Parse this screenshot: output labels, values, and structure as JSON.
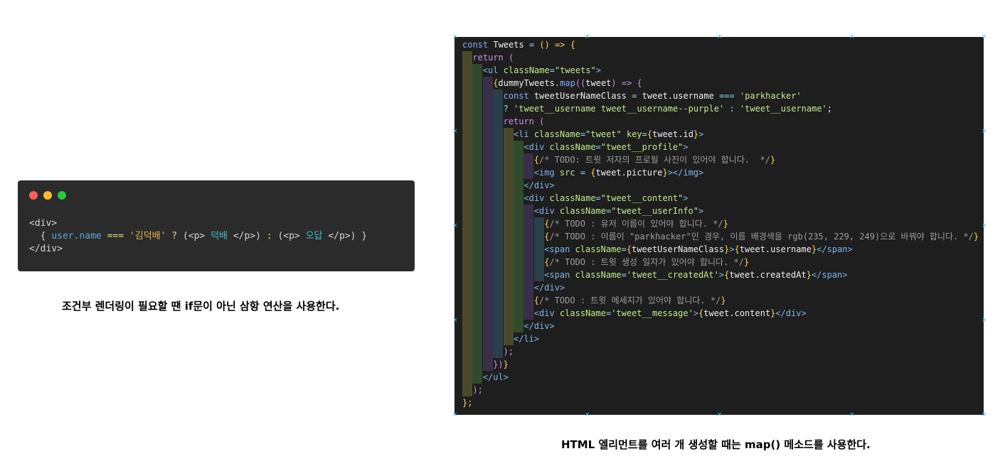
{
  "left_panel": {
    "dot_colors": [
      "#ff5f57",
      "#febc2e",
      "#28c840"
    ],
    "snippet_lines": [
      [
        {
          "t": "<div>",
          "c": "plain"
        }
      ],
      [
        {
          "t": "  { ",
          "c": "plain"
        },
        {
          "t": "user.name",
          "c": "var"
        },
        {
          "t": " === ",
          "c": "op"
        },
        {
          "t": "'김덕배'",
          "c": "str"
        },
        {
          "t": " ? ",
          "c": "op"
        },
        {
          "t": "(<p> ",
          "c": "plain"
        },
        {
          "t": "덕배",
          "c": "kor"
        },
        {
          "t": " </p>) ",
          "c": "plain"
        },
        {
          "t": ":",
          "c": "op"
        },
        {
          "t": " (<p> ",
          "c": "plain"
        },
        {
          "t": "오답",
          "c": "kor"
        },
        {
          "t": " </p>) }",
          "c": "plain"
        }
      ],
      [
        {
          "t": "</div>",
          "c": "plain"
        }
      ]
    ],
    "caption": "조건부 렌더링이 필요할 땐 if문이 아닌 삼항 연산을 사용한다."
  },
  "right_panel": {
    "caption": "HTML 엘리먼트를 여러 개 생성할 때는 map() 메소드를 사용한다.",
    "guide_colors": [
      "#4a4a2a",
      "#2f4a2f",
      "#3a2f4a",
      "#2a3f4a",
      "#4a4a2a",
      "#2f4a2f",
      "#3a2f4a",
      "#2a3f4a"
    ],
    "code_lines": [
      {
        "i": 0,
        "s": [
          {
            "t": "const ",
            "c": "var"
          },
          {
            "t": "Tweets",
            "c": "plain"
          },
          {
            "t": " = ",
            "c": "punc"
          },
          {
            "t": "() => {",
            "c": "brace"
          }
        ]
      },
      {
        "i": 1,
        "s": [
          {
            "t": "return (",
            "c": "kw"
          }
        ]
      },
      {
        "i": 2,
        "s": [
          {
            "t": "<ul ",
            "c": "tag"
          },
          {
            "t": "className",
            "c": "attr"
          },
          {
            "t": "=",
            "c": "punc"
          },
          {
            "t": "\"tweets\"",
            "c": "str"
          },
          {
            "t": ">",
            "c": "tag"
          }
        ]
      },
      {
        "i": 3,
        "s": [
          {
            "t": "{",
            "c": "brace"
          },
          {
            "t": "dummyTweets",
            "c": "plain"
          },
          {
            "t": ".",
            "c": "punc"
          },
          {
            "t": "map",
            "c": "fn"
          },
          {
            "t": "((",
            "c": "kw"
          },
          {
            "t": "tweet",
            "c": "plain"
          },
          {
            "t": ") => {",
            "c": "kw"
          }
        ]
      },
      {
        "i": 4,
        "s": [
          {
            "t": "const ",
            "c": "var"
          },
          {
            "t": "tweetUserNameClass",
            "c": "plain"
          },
          {
            "t": " = ",
            "c": "punc"
          },
          {
            "t": "tweet.username",
            "c": "plain"
          },
          {
            "t": " === ",
            "c": "punc"
          },
          {
            "t": "'parkhacker'",
            "c": "str"
          }
        ]
      },
      {
        "i": 4,
        "s": [
          {
            "t": "? ",
            "c": "punc"
          },
          {
            "t": "'tweet__username tweet__username--purple'",
            "c": "str"
          },
          {
            "t": " : ",
            "c": "punc"
          },
          {
            "t": "'tweet__username'",
            "c": "str"
          },
          {
            "t": ";",
            "c": "plain"
          }
        ]
      },
      {
        "i": 4,
        "s": [
          {
            "t": "return (",
            "c": "kw"
          }
        ]
      },
      {
        "i": 5,
        "s": [
          {
            "t": "<li ",
            "c": "tag"
          },
          {
            "t": "className",
            "c": "attr"
          },
          {
            "t": "=",
            "c": "punc"
          },
          {
            "t": "\"tweet\"",
            "c": "str"
          },
          {
            "t": " key",
            "c": "attr"
          },
          {
            "t": "=",
            "c": "punc"
          },
          {
            "t": "{",
            "c": "brace"
          },
          {
            "t": "tweet.id",
            "c": "plain"
          },
          {
            "t": "}",
            "c": "brace"
          },
          {
            "t": ">",
            "c": "tag"
          }
        ]
      },
      {
        "i": 6,
        "s": [
          {
            "t": "<div ",
            "c": "tag"
          },
          {
            "t": "className",
            "c": "attr"
          },
          {
            "t": "=",
            "c": "punc"
          },
          {
            "t": "\"tweet__profile\"",
            "c": "str"
          },
          {
            "t": ">",
            "c": "tag"
          }
        ]
      },
      {
        "i": 7,
        "s": [
          {
            "t": "{",
            "c": "brace"
          },
          {
            "t": "/* TODO: 트윗 저자의 프로필 사진이 있어야 합니다.  */",
            "c": "cmt"
          },
          {
            "t": "}",
            "c": "brace"
          }
        ]
      },
      {
        "i": 7,
        "s": [
          {
            "t": "<img ",
            "c": "tag"
          },
          {
            "t": "src",
            "c": "attr"
          },
          {
            "t": " = ",
            "c": "punc"
          },
          {
            "t": "{",
            "c": "brace"
          },
          {
            "t": "tweet.picture",
            "c": "plain"
          },
          {
            "t": "}",
            "c": "brace"
          },
          {
            "t": "></img>",
            "c": "tag"
          }
        ]
      },
      {
        "i": 6,
        "s": [
          {
            "t": "</div>",
            "c": "tag"
          }
        ]
      },
      {
        "i": 6,
        "s": [
          {
            "t": "<div ",
            "c": "tag"
          },
          {
            "t": "className",
            "c": "attr"
          },
          {
            "t": "=",
            "c": "punc"
          },
          {
            "t": "\"tweet__content\"",
            "c": "str"
          },
          {
            "t": ">",
            "c": "tag"
          }
        ]
      },
      {
        "i": 7,
        "s": [
          {
            "t": "<div ",
            "c": "tag"
          },
          {
            "t": "className",
            "c": "attr"
          },
          {
            "t": "=",
            "c": "punc"
          },
          {
            "t": "\"tweet__userInfo\"",
            "c": "str"
          },
          {
            "t": ">",
            "c": "tag"
          }
        ]
      },
      {
        "i": 8,
        "s": [
          {
            "t": "{",
            "c": "brace"
          },
          {
            "t": "/* TODO : 유저 이름이 있어야 합니다. */",
            "c": "cmt"
          },
          {
            "t": "}",
            "c": "brace"
          }
        ]
      },
      {
        "i": 8,
        "s": [
          {
            "t": "{",
            "c": "brace"
          },
          {
            "t": "/* TODO : 이름이 \"parkhacker\"인 경우, 이름 배경색을 rgb(235, 229, 249)으로 바꿔야 합니다. */",
            "c": "cmt"
          },
          {
            "t": "}",
            "c": "brace"
          }
        ]
      },
      {
        "i": 8,
        "s": [
          {
            "t": "<span ",
            "c": "tag"
          },
          {
            "t": "className",
            "c": "attr"
          },
          {
            "t": "=",
            "c": "punc"
          },
          {
            "t": "{",
            "c": "brace"
          },
          {
            "t": "tweetUserNameClass",
            "c": "plain"
          },
          {
            "t": "}",
            "c": "brace"
          },
          {
            "t": ">",
            "c": "tag"
          },
          {
            "t": "{",
            "c": "brace"
          },
          {
            "t": "tweet.username",
            "c": "plain"
          },
          {
            "t": "}",
            "c": "brace"
          },
          {
            "t": "</span>",
            "c": "tag"
          }
        ]
      },
      {
        "i": 8,
        "s": [
          {
            "t": "{",
            "c": "brace"
          },
          {
            "t": "/* TODO : 트윗 생성 일자가 있어야 합니다. */",
            "c": "cmt"
          },
          {
            "t": "}",
            "c": "brace"
          }
        ]
      },
      {
        "i": 8,
        "s": [
          {
            "t": "<span ",
            "c": "tag"
          },
          {
            "t": "className",
            "c": "attr"
          },
          {
            "t": "=",
            "c": "punc"
          },
          {
            "t": "'tweet__createdAt'",
            "c": "str"
          },
          {
            "t": ">",
            "c": "tag"
          },
          {
            "t": "{",
            "c": "brace"
          },
          {
            "t": "tweet.createdAt",
            "c": "plain"
          },
          {
            "t": "}",
            "c": "brace"
          },
          {
            "t": "</span>",
            "c": "tag"
          }
        ]
      },
      {
        "i": 7,
        "s": [
          {
            "t": "</div>",
            "c": "tag"
          }
        ]
      },
      {
        "i": 7,
        "s": [
          {
            "t": "{",
            "c": "brace"
          },
          {
            "t": "/* TODO : 트윗 메세지가 있어야 합니다. */",
            "c": "cmt"
          },
          {
            "t": "}",
            "c": "brace"
          }
        ]
      },
      {
        "i": 7,
        "s": [
          {
            "t": "<div ",
            "c": "tag"
          },
          {
            "t": "className",
            "c": "attr"
          },
          {
            "t": "=",
            "c": "punc"
          },
          {
            "t": "'tweet__message'",
            "c": "str"
          },
          {
            "t": ">",
            "c": "tag"
          },
          {
            "t": "{",
            "c": "brace"
          },
          {
            "t": "tweet.content",
            "c": "plain"
          },
          {
            "t": "}",
            "c": "brace"
          },
          {
            "t": "</div>",
            "c": "tag"
          }
        ]
      },
      {
        "i": 6,
        "s": [
          {
            "t": "</div>",
            "c": "tag"
          }
        ]
      },
      {
        "i": 5,
        "s": [
          {
            "t": "</li>",
            "c": "tag"
          }
        ]
      },
      {
        "i": 4,
        "s": [
          {
            "t": ");",
            "c": "kw"
          }
        ]
      },
      {
        "i": 3,
        "s": [
          {
            "t": "})",
            "c": "kw"
          },
          {
            "t": "}",
            "c": "brace"
          }
        ]
      },
      {
        "i": 2,
        "s": [
          {
            "t": "</ul>",
            "c": "tag"
          }
        ]
      },
      {
        "i": 1,
        "s": [
          {
            "t": ");",
            "c": "kw"
          }
        ]
      },
      {
        "i": 0,
        "s": [
          {
            "t": "};",
            "c": "brace"
          }
        ]
      }
    ]
  }
}
